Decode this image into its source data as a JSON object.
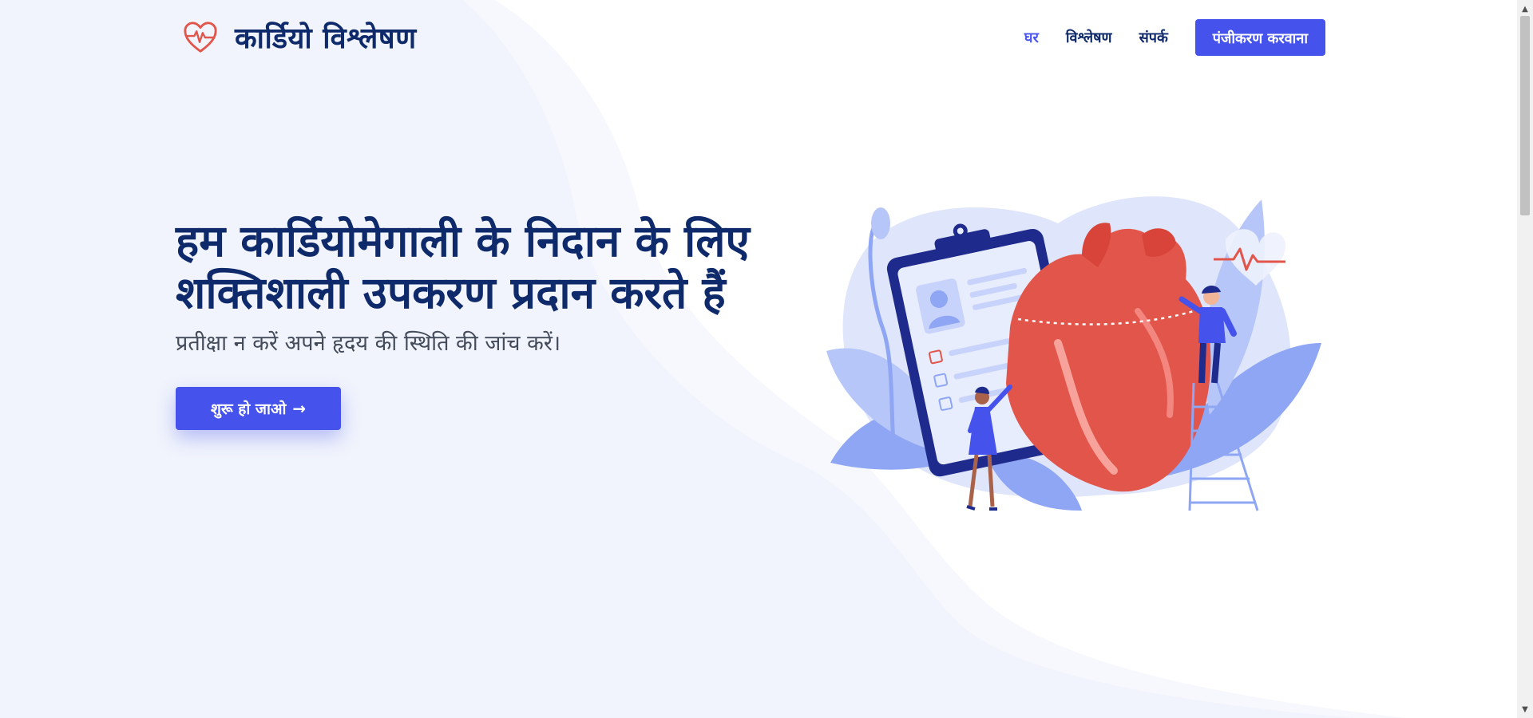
{
  "brand": {
    "name": "कार्डियो विश्लेषण",
    "logo_icon": "heart-pulse-icon"
  },
  "nav": {
    "items": [
      {
        "label": "घर",
        "active": true
      },
      {
        "label": "विश्लेषण",
        "active": false
      },
      {
        "label": "संपर्क",
        "active": false
      }
    ],
    "register_label": "पंजीकरण करवाना"
  },
  "hero": {
    "title": "हम कार्डियोमेगाली के निदान के लिए शक्तिशाली उपकरण प्रदान करते हैं",
    "subtitle": "प्रतीक्षा न करें अपने हृदय की स्थिति की जांच करें।",
    "cta_label": "शुरू हो जाओ",
    "cta_icon": "arrow-right-icon",
    "illustration": "heart-diagnosis-illustration"
  },
  "colors": {
    "primary": "#4552ec",
    "heading": "#0f2a6b",
    "heart": "#e2554a",
    "wave": "#eef2fb"
  }
}
